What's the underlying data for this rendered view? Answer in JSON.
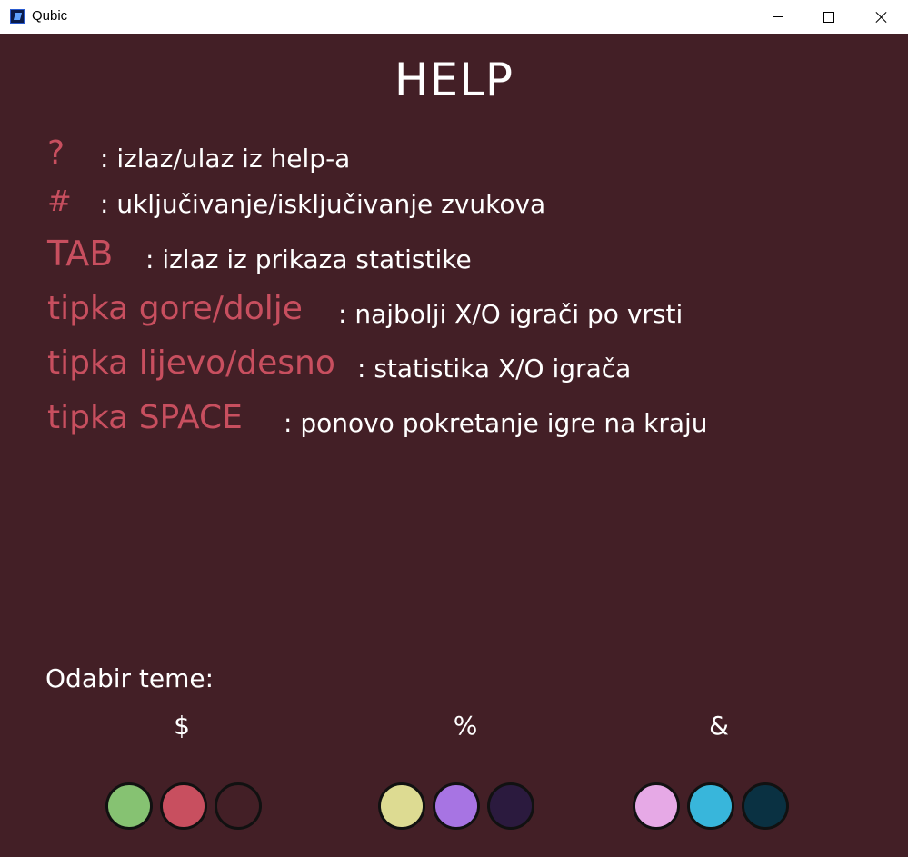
{
  "window": {
    "title": "Qubic",
    "minimize_icon": "minimize-icon",
    "maximize_icon": "maximize-icon",
    "close_icon": "close-icon"
  },
  "help": {
    "title": "HELP",
    "entries": [
      {
        "key": "?",
        "description": ": izlaz/ulaz iz help-a"
      },
      {
        "key": "#",
        "description": ": uključivanje/isključivanje zvukova"
      },
      {
        "key": "TAB",
        "description": ": izlaz iz prikaza statistike"
      },
      {
        "key": "tipka gore/dolje",
        "description": ":  najbolji X/O igrači po vrsti"
      },
      {
        "key": "tipka lijevo/desno",
        "description": ":  statistika X/O igrača"
      },
      {
        "key": "tipka SPACE",
        "description": ":  ponovo pokretanje igre na kraju"
      }
    ]
  },
  "themes": {
    "label": "Odabir teme:",
    "options": [
      {
        "symbol": "$",
        "colors": [
          "#86c272",
          "#c84f5f",
          "#431f26"
        ]
      },
      {
        "symbol": "%",
        "colors": [
          "#dddb92",
          "#a774e3",
          "#2b1a3e"
        ]
      },
      {
        "symbol": "&",
        "colors": [
          "#e6a9e6",
          "#38b6db",
          "#0a3142"
        ]
      }
    ]
  }
}
